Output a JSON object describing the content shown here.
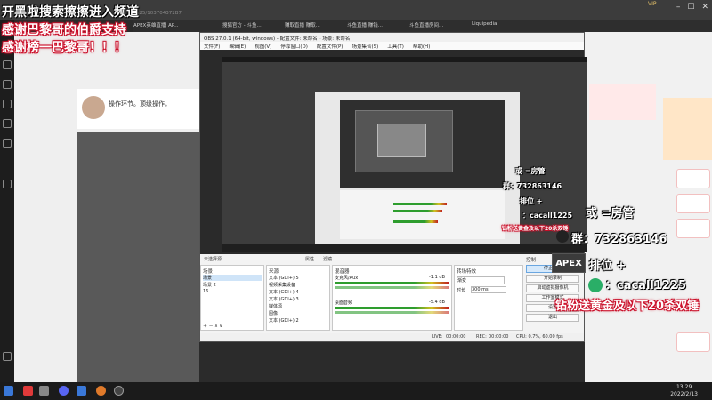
{
  "overlays": {
    "title_line": "开黑啦搜索擦擦进入频道",
    "thanks_line_1": "感谢巴黎哥的伯爵支持",
    "thanks_line_2": "感谢榜一巴黎哥！！！",
    "or_admin": "或 =房管",
    "qq_group": "群：732863146",
    "rank": "排位 +",
    "wechat": "：cacall1225",
    "gift_note": "钻粉送黄金及以下20杀双锤",
    "apex_badge": "APEX"
  },
  "browser": {
    "url": "ds25/103704372B7",
    "vip": "VIP",
    "tabs": [
      "APEX英雄直播_AP...",
      "搜狐官方 - 斗鱼...",
      "赚取直播 赚取...",
      "斗鱼直播 赚钱...",
      "斗鱼直播房间...",
      "Liquipedia"
    ]
  },
  "sidebar_left": {
    "stream_desc": "操作环节。顶级操作。"
  },
  "obs": {
    "window_title": "OBS 27.0.1 (64-bit, windows) - 配置文件: 未命名 - 场景: 未命名",
    "menu": [
      "文件(F)",
      "编辑(E)",
      "视图(V)",
      "停靠窗口(D)",
      "配置文件(P)",
      "场景集合(S)",
      "工具(T)",
      "帮助(H)"
    ],
    "preview_tags": {
      "or_admin": "或 =房管",
      "qq_group": "群：732863146",
      "rank": "排位 +",
      "wechat": "：cacall1225",
      "gift_note": "钻粉送黄金及以下20杀双锤"
    },
    "scene_tabs": [
      "未选择源",
      "属性",
      "滤镜"
    ],
    "docks": {
      "scenes": {
        "title": "场景",
        "items": [
          "场景",
          "场景 2",
          "16"
        ]
      },
      "sources": {
        "title": "来源",
        "items": [
          "文本 (GDI+) 5",
          "视频采集设备",
          "文本 (GDI+) 4",
          "文本 (GDI+) 3",
          "媒体源",
          "图像",
          "文本 (GDI+) 2"
        ]
      },
      "mixer": {
        "title": "混音器",
        "ch1": "麦克风/Aux",
        "ch1_db": "-1.1 dB",
        "ch2": "桌面音频",
        "ch2_db": "-5.4 dB"
      },
      "transitions": {
        "title": "转场特效",
        "mode": "渐变",
        "duration_label": "时长",
        "duration_value": "300 ms"
      },
      "controls": {
        "title": "控制",
        "buttons": [
          "停止推流",
          "开始录制",
          "启动虚拟摄像机",
          "工作室模式",
          "设置",
          "退出"
        ]
      }
    },
    "status": {
      "live_label": "LIVE:",
      "live_time": "00:00:00",
      "rec_label": "REC:",
      "rec_time": "00:00:00",
      "cpu": "CPU: 0.7%, 60.00 fps"
    }
  },
  "taskbar": {
    "time": "13:29",
    "date": "2022/2/13"
  },
  "colors": {
    "overlay_red": "#c8102a",
    "obs_bg": "#2a2a2a",
    "stop_stream_btn": "#d6e9fb",
    "wechat_green": "#2aae67"
  }
}
